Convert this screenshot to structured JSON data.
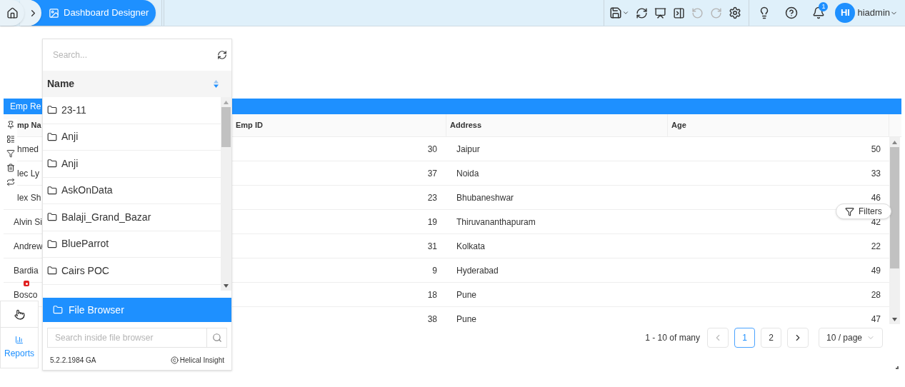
{
  "breadcrumb": {
    "current": "Dashboard Designer"
  },
  "user": {
    "initials": "HI",
    "name": "hiadmin",
    "notifications": "1"
  },
  "report": {
    "title": "Emp Re",
    "columns": [
      "mp Na",
      "Emp ID",
      "Address",
      "Age"
    ],
    "rows": [
      {
        "name": "hmed",
        "emp_id": "30",
        "address": "Jaipur",
        "age": "50"
      },
      {
        "name": "lec Ly",
        "emp_id": "37",
        "address": "Noida",
        "age": "33"
      },
      {
        "name": "lex Sh",
        "emp_id": "23",
        "address": "Bhubaneshwar",
        "age": "46"
      },
      {
        "name": "Alvin Si",
        "emp_id": "19",
        "address": "Thiruvananthapuram",
        "age": "42"
      },
      {
        "name": "Andrew",
        "emp_id": "31",
        "address": "Kolkata",
        "age": "22"
      },
      {
        "name": "Bardia",
        "emp_id": "9",
        "address": "Hyderabad",
        "age": "49"
      },
      {
        "name": "Bosco",
        "emp_id": "18",
        "address": "Pune",
        "age": "28"
      },
      {
        "emp_id": "38",
        "address": "Pune",
        "age": "47"
      }
    ],
    "filters_button": "Filters",
    "pagination": {
      "range": "1 - 10 of many",
      "pages": [
        {
          "label": "1",
          "selected": true
        },
        {
          "label": "2",
          "selected": false
        }
      ],
      "page_size": "10 / page"
    }
  },
  "left_dock": {
    "reports_label": "Reports"
  },
  "file_browser": {
    "search_placeholder": "Search...",
    "column": "Name",
    "folders": [
      "23-11",
      "Anji",
      "Anji",
      "AskOnData",
      "Balaji_Grand_Bazar",
      "BlueParrot",
      "Cairs POC"
    ],
    "section": {
      "label": "File Browser",
      "selected": true
    },
    "inner_search_placeholder": "Search inside file browser",
    "version": "5.2.2.1984 GA",
    "brand": "Helical Insight"
  }
}
